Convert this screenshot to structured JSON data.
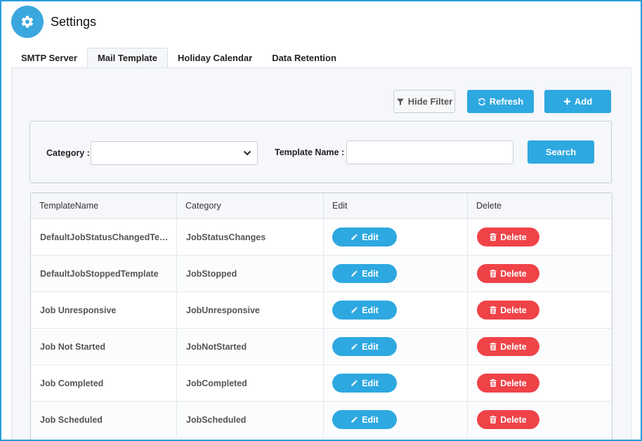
{
  "header": {
    "title": "Settings",
    "icon": "gear-icon"
  },
  "tabs": [
    {
      "label": "SMTP Server",
      "active": false
    },
    {
      "label": "Mail Template",
      "active": true
    },
    {
      "label": "Holiday Calendar",
      "active": false
    },
    {
      "label": "Data Retention",
      "active": false
    }
  ],
  "toolbar": {
    "hide_filter_label": "Hide Filter",
    "refresh_label": "Refresh",
    "add_label": "Add"
  },
  "filter": {
    "category_label": "Category :",
    "category_value": "",
    "template_name_label": "Template Name :",
    "template_name_value": "",
    "search_label": "Search"
  },
  "table": {
    "columns": [
      "TemplateName",
      "Category",
      "Edit",
      "Delete"
    ],
    "edit_label": "Edit",
    "delete_label": "Delete",
    "rows": [
      {
        "name": "DefaultJobStatusChangedTemplate",
        "category": "JobStatusChanges"
      },
      {
        "name": "DefaultJobStoppedTemplate",
        "category": "JobStopped"
      },
      {
        "name": "Job Unresponsive",
        "category": "JobUnresponsive"
      },
      {
        "name": "Job Not Started",
        "category": "JobNotStarted"
      },
      {
        "name": "Job Completed",
        "category": "JobCompleted"
      },
      {
        "name": "Job Scheduled",
        "category": "JobScheduled"
      }
    ]
  },
  "colors": {
    "accent": "#2ea8e0",
    "danger": "#ef4348",
    "frame_border": "#2a9ddb"
  }
}
